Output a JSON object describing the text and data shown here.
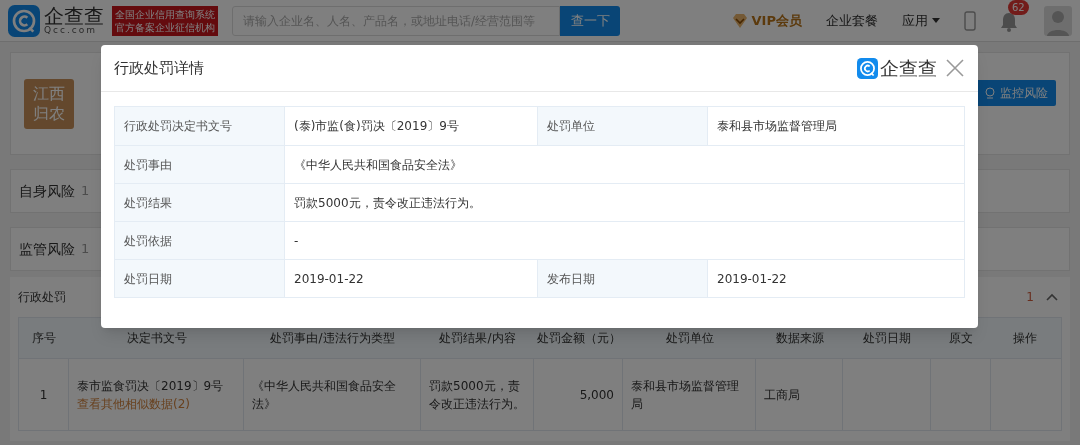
{
  "header": {
    "brand": "企查查",
    "domain": "Qcc.com",
    "badge_lines": [
      "全国企业信用查询系统",
      "官方备案企业征信机构"
    ],
    "search": {
      "placeholder": "请输入企业名、人名、产品名，或地址电话/经营范围等"
    },
    "search_button": "查一下",
    "nav": [
      {
        "kind": "vip",
        "label": "VIP会员"
      },
      {
        "kind": "plain",
        "label": "企业套餐"
      },
      {
        "kind": "dropdown",
        "label": "应用"
      }
    ],
    "notification_count": "62"
  },
  "company": {
    "logo_lines": [
      "江西",
      "归农"
    ],
    "monitor_button": "监控风险"
  },
  "sections": [
    {
      "title": "自身风险",
      "count": "1"
    },
    {
      "title": "监管风险",
      "count": "1"
    }
  ],
  "subsection": {
    "title": "行政处罚",
    "count": "1",
    "expanded": true
  },
  "table": {
    "columns": [
      "序号",
      "决定书文号",
      "处罚事由/违法行为类型",
      "处罚结果/内容",
      "处罚金额（元）",
      "处罚单位",
      "数据来源",
      "处罚日期",
      "原文",
      "操作"
    ],
    "rows": [
      {
        "index": "1",
        "doc_no": "泰市监食罚决〔2019〕9号",
        "link": "查看其他相似数据(2)",
        "reason": "《中华人民共和国食品安全法》",
        "result": "罚款5000元，责令改正违法行为。",
        "amount": "5,000",
        "unit": "泰和县市场监督管理局",
        "source": "工商局"
      }
    ]
  },
  "modal": {
    "title": "行政处罚详情",
    "brand": "企查查",
    "rows": [
      {
        "cells": [
          {
            "label": "行政处罚决定书文号",
            "value": "(泰)市监(食)罚决〔2019〕9号"
          },
          {
            "label": "处罚单位",
            "value": "泰和县市场监督管理局"
          }
        ]
      },
      {
        "cells": [
          {
            "label": "处罚事由",
            "value": "《中华人民共和国食品安全法》"
          }
        ]
      },
      {
        "cells": [
          {
            "label": "处罚结果",
            "value": "罚款5000元，责令改正违法行为。"
          }
        ]
      },
      {
        "cells": [
          {
            "label": "处罚依据",
            "value": "-"
          }
        ]
      },
      {
        "cells": [
          {
            "label": "处罚日期",
            "value": "2019-01-22"
          },
          {
            "label": "发布日期",
            "value": "2019-01-22"
          }
        ]
      }
    ]
  }
}
